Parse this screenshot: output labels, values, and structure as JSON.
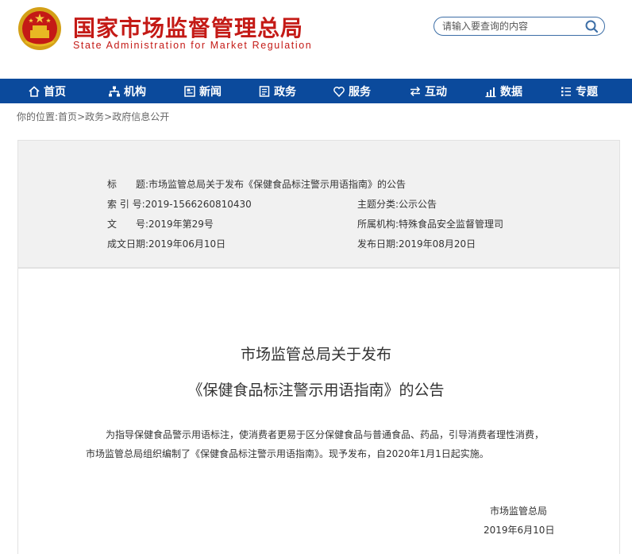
{
  "header": {
    "site_name_cn": "国家市场监督管理总局",
    "site_name_en": "State Administration for Market Regulation",
    "search_placeholder": "请输入要查询的内容",
    "brand_color": "#c41a16",
    "nav_color": "#0b4a9c"
  },
  "nav": [
    {
      "label": "首页",
      "icon": "home-icon"
    },
    {
      "label": "机构",
      "icon": "org-chart-icon"
    },
    {
      "label": "新闻",
      "icon": "news-icon"
    },
    {
      "label": "政务",
      "icon": "government-icon"
    },
    {
      "label": "服务",
      "icon": "heart-icon"
    },
    {
      "label": "互动",
      "icon": "exchange-icon"
    },
    {
      "label": "数据",
      "icon": "data-chart-icon"
    },
    {
      "label": "专题",
      "icon": "list-icon"
    }
  ],
  "breadcrumb": {
    "prefix": "你的位置:",
    "items": [
      "首页",
      "政务",
      "政府信息公开"
    ],
    "separator": ">"
  },
  "info": {
    "title_label": "标　　题:",
    "title_value": "市场监管总局关于发布《保健食品标注警示用语指南》的公告",
    "index_label": "索 引 号:",
    "index_value": "2019-1566260810430",
    "category_label": "主题分类:",
    "category_value": "公示公告",
    "doc_no_label": "文　　号:",
    "doc_no_value": "2019年第29号",
    "org_label": "所属机构:",
    "org_value": "特殊食品安全监督管理司",
    "created_label": "成文日期:",
    "created_value": "2019年06月10日",
    "published_label": "发布日期:",
    "published_value": "2019年08月20日"
  },
  "article": {
    "title_line1": "市场监管总局关于发布",
    "title_line2": "《保健食品标注警示用语指南》的公告",
    "para_line1": "为指导保健食品警示用语标注，使消费者更易于区分保健食品与普通食品、药品，引导消费者理性消费，",
    "para_line2": "市场监管总局组织编制了《保健食品标注警示用语指南》。现予发布，自2020年1月1日起实施。",
    "signer": "市场监管总局",
    "sign_date": "2019年6月10日"
  }
}
